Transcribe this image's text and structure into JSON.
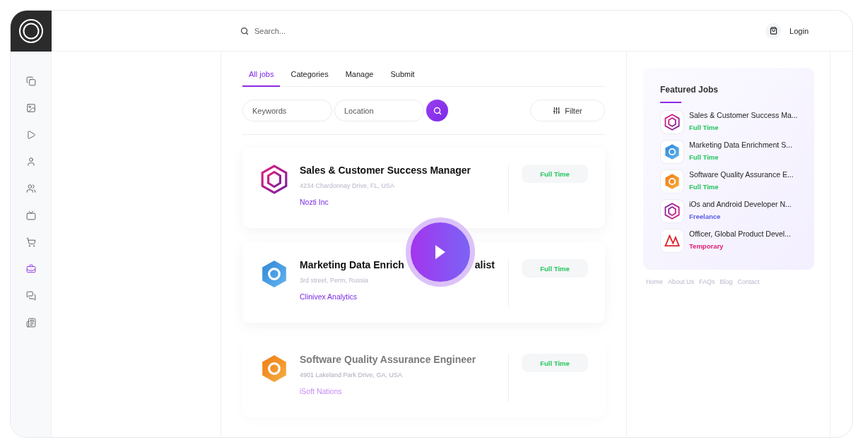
{
  "header": {
    "search": {
      "placeholder": "Search..."
    },
    "login": "Login"
  },
  "sidebar": {
    "items": [
      {
        "selected": false
      },
      {
        "selected": false
      },
      {
        "selected": false
      },
      {
        "selected": false
      },
      {
        "selected": false
      },
      {
        "selected": false
      },
      {
        "selected": false
      },
      {
        "selected": true
      },
      {
        "selected": false
      },
      {
        "selected": false
      }
    ]
  },
  "tabs": [
    {
      "label": "All jobs",
      "selected": true
    },
    {
      "label": "Categories",
      "selected": false
    },
    {
      "label": "Manage",
      "selected": false
    },
    {
      "label": "Submit",
      "selected": false
    }
  ],
  "filters": {
    "keywords": {
      "placeholder": "Keywords"
    },
    "location": {
      "placeholder": "Location"
    },
    "filter_button": "Filter"
  },
  "jobs": [
    {
      "title": "Sales & Customer Success Manager",
      "address": "4234 Chardonnay Drive, FL, USA",
      "company": "Nozti Inc",
      "type": "Full Time",
      "color": "#22c55e",
      "faded": false
    },
    {
      "title": "Marketing Data Enrich",
      "title_end": "alist",
      "address": "3rd street, Perm, Russia",
      "company": "Clinivex Analytics",
      "type": "Full Time",
      "color": "#22c55e",
      "faded": false
    },
    {
      "title": "Software Quality Assurance Engineer",
      "address": "4901 Lakeland Park Drive, GA, USA",
      "company": "iSoft Nations",
      "type": "Full Time",
      "color": "#22c55e",
      "faded": true
    }
  ],
  "featured": {
    "title": "Featured Jobs",
    "items": [
      {
        "title": "Sales & Customer Success Ma...",
        "type": "Full Time",
        "color": "#22c55e"
      },
      {
        "title": "Marketing Data Enrichment S...",
        "type": "Full Time",
        "color": "#22c55e"
      },
      {
        "title": "Software Quality Assurance E...",
        "type": "Full Time",
        "color": "#22c55e"
      },
      {
        "title": "iOs and Android Developer N...",
        "type": "Freelance",
        "color": "#5b5ce6"
      },
      {
        "title": "Officer, Global Product Devel...",
        "type": "Temporary",
        "color": "#e11d74"
      }
    ]
  },
  "footer_links": [
    "Home",
    "About Us",
    "FAQs",
    "Blog",
    "Contact"
  ]
}
